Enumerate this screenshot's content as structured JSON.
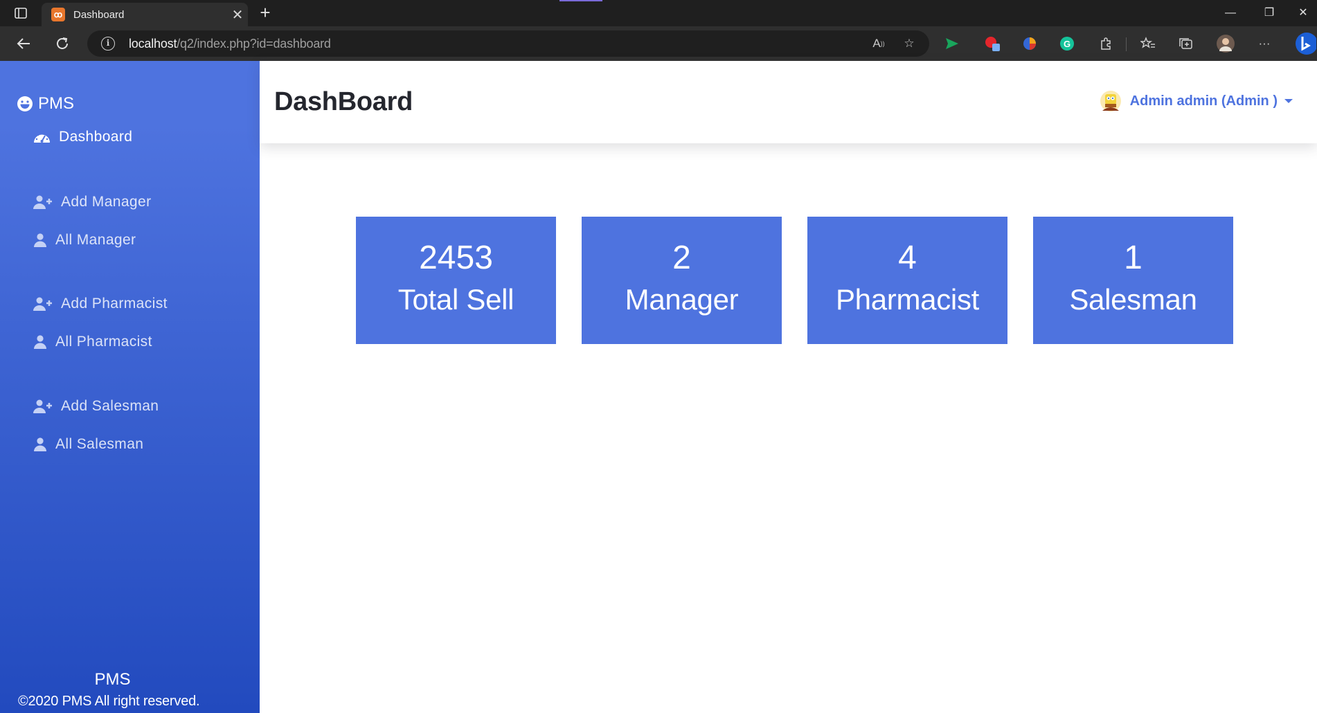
{
  "browser": {
    "tab_title": "Dashboard",
    "tab_favicon": "xampp-icon",
    "url_host": "localhost",
    "url_path": "/q2/index.php?id=dashboard"
  },
  "sidebar": {
    "brand": "PMS",
    "brand_icon": "laugh-icon",
    "items": [
      {
        "label": "Dashboard",
        "icon": "tachometer-icon",
        "active": true
      },
      {
        "label": "Add Manager",
        "icon": "user-plus-icon"
      },
      {
        "label": "All Manager",
        "icon": "user-icon"
      },
      {
        "label": "Add Pharmacist",
        "icon": "user-plus-icon"
      },
      {
        "label": "All Pharmacist",
        "icon": "user-icon"
      },
      {
        "label": "Add Salesman",
        "icon": "user-plus-icon"
      },
      {
        "label": "All Salesman",
        "icon": "user-icon"
      }
    ],
    "footer_brand": "PMS",
    "footer_copy": "©2020 PMS All right reserved."
  },
  "header": {
    "title": "DashBoard",
    "user_name": "Admin admin (Admin )"
  },
  "cards": [
    {
      "value": "2453",
      "label": "Total Sell"
    },
    {
      "value": "2",
      "label": "Manager"
    },
    {
      "value": "4",
      "label": "Pharmacist"
    },
    {
      "value": "1",
      "label": "Salesman"
    }
  ],
  "colors": {
    "primary": "#4e73df",
    "sidebar_gradient_end": "#224abe",
    "title_text": "#24262e"
  }
}
